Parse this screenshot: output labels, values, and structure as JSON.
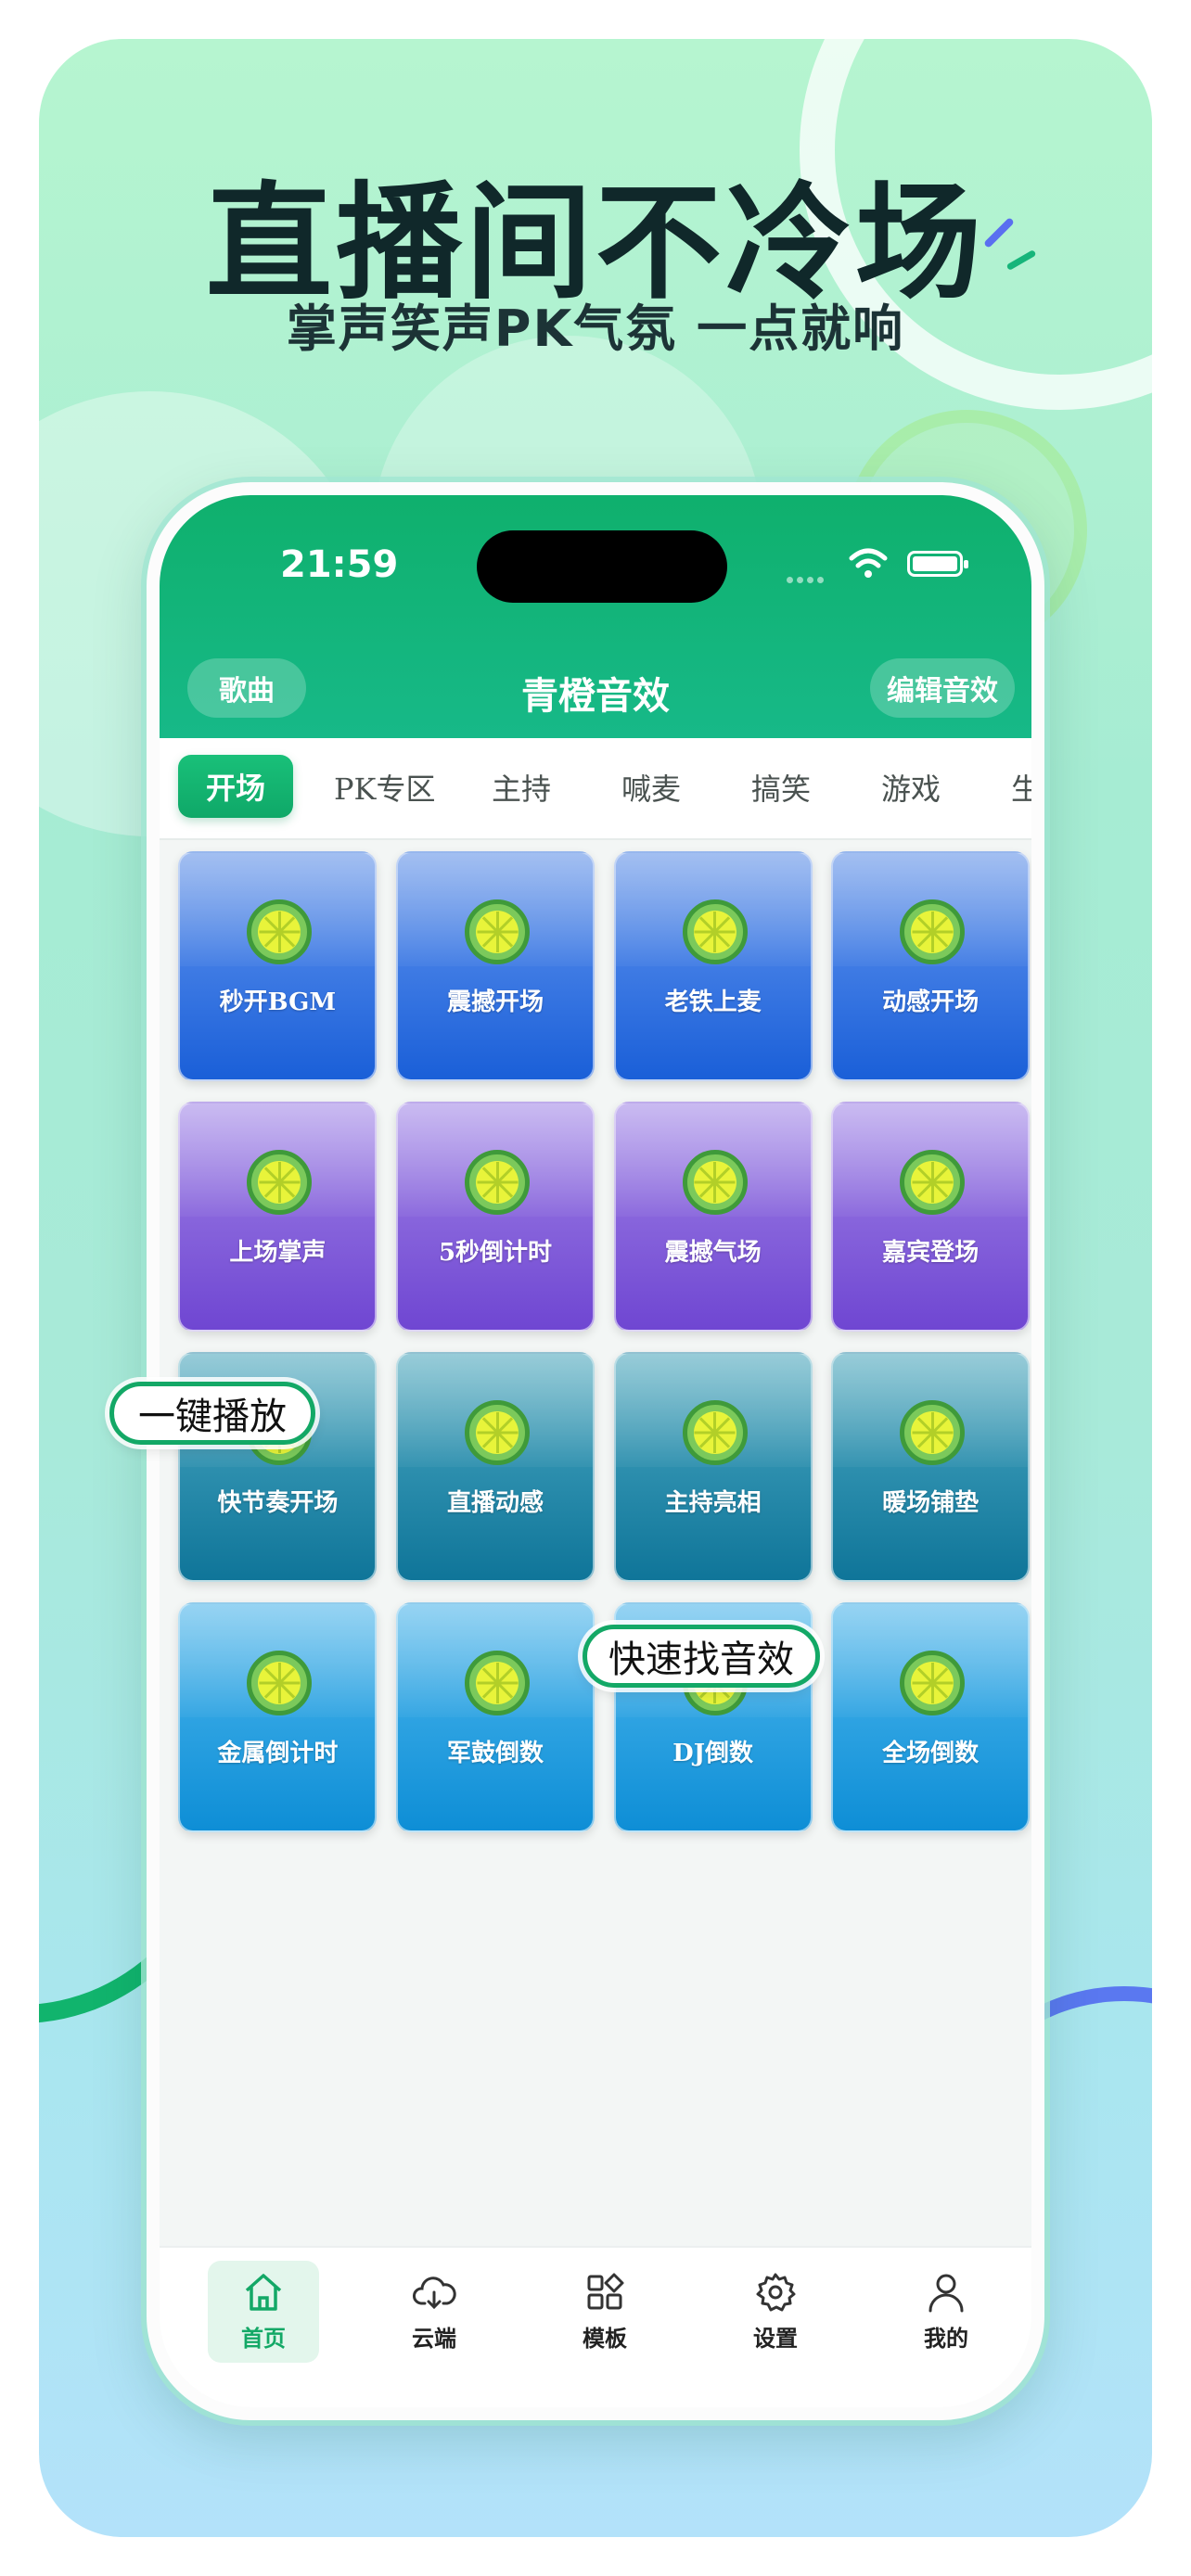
{
  "promo": {
    "headline": "直播间不冷场",
    "subline": "掌声笑声PK气氛  一点就响"
  },
  "status_bar": {
    "time": "21:59"
  },
  "nav": {
    "left_button": "歌曲",
    "title": "青橙音效",
    "right_button": "编辑音效"
  },
  "tabs": [
    "开场",
    "PK专区",
    "主持",
    "喊麦",
    "搞笑",
    "游戏",
    "生"
  ],
  "active_tab": "开场",
  "tiles": [
    {
      "label": "秒开BGM",
      "color": "blue"
    },
    {
      "label": "震撼开场",
      "color": "blue"
    },
    {
      "label": "老铁上麦",
      "color": "blue"
    },
    {
      "label": "动感开场",
      "color": "blue"
    },
    {
      "label": "上场掌声",
      "color": "purple"
    },
    {
      "label": "5秒倒计时",
      "color": "purple"
    },
    {
      "label": "震撼气场",
      "color": "purple"
    },
    {
      "label": "嘉宾登场",
      "color": "purple"
    },
    {
      "label": "快节奏开场",
      "color": "teal"
    },
    {
      "label": "直播动感",
      "color": "teal"
    },
    {
      "label": "主持亮相",
      "color": "teal"
    },
    {
      "label": "暖场铺垫",
      "color": "teal"
    },
    {
      "label": "金属倒计时",
      "color": "sky"
    },
    {
      "label": "军鼓倒数",
      "color": "sky"
    },
    {
      "label": "DJ倒数",
      "color": "sky"
    },
    {
      "label": "全场倒数",
      "color": "sky"
    }
  ],
  "bottom_nav": [
    {
      "label": "首页",
      "icon": "home-icon",
      "active": true
    },
    {
      "label": "云端",
      "icon": "cloud-download-icon",
      "active": false
    },
    {
      "label": "模板",
      "icon": "template-grid-icon",
      "active": false
    },
    {
      "label": "设置",
      "icon": "gear-icon",
      "active": false
    },
    {
      "label": "我的",
      "icon": "user-icon",
      "active": false
    }
  ],
  "callouts": {
    "one_tap": "一键播放",
    "quick_find": "快速找音效"
  },
  "colors": {
    "brand_green": "#13a866",
    "tile_blue": "#1a5fd8",
    "tile_purple": "#6f46d2",
    "tile_teal": "#0f7599",
    "tile_sky": "#0e8ed6"
  }
}
